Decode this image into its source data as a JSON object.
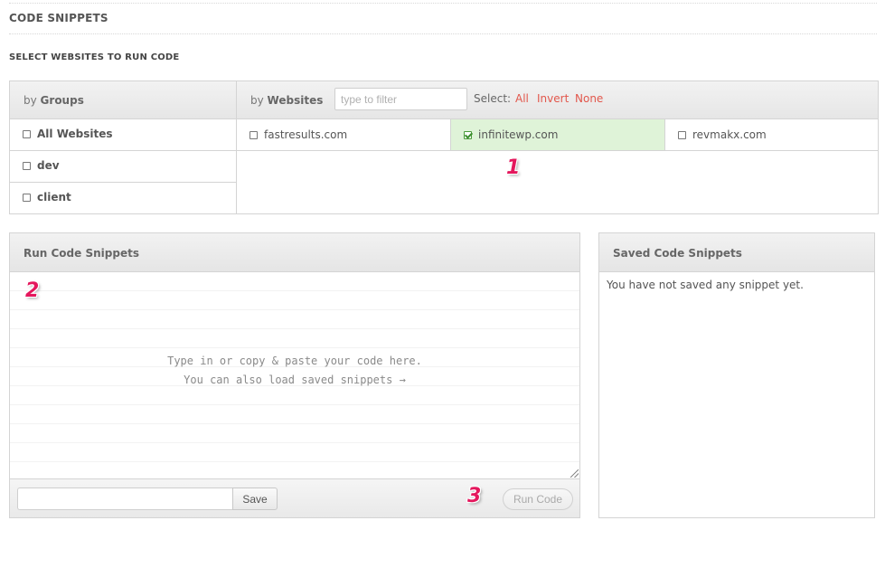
{
  "page": {
    "title": "CODE SNIPPETS",
    "section_title": "SELECT WEBSITES TO RUN CODE"
  },
  "selector": {
    "groups_header_prefix": "by",
    "groups_header": "Groups",
    "websites_header_prefix": "by",
    "websites_header": "Websites",
    "filter_placeholder": "type to filter",
    "select_label": "Select:",
    "select_all": "All",
    "select_invert": "Invert",
    "select_none": "None",
    "groups": [
      {
        "label": "All Websites",
        "checked": false
      },
      {
        "label": "dev",
        "checked": false
      },
      {
        "label": "client",
        "checked": false
      }
    ],
    "websites": [
      {
        "label": "fastresults.com",
        "checked": false
      },
      {
        "label": "infinitewp.com",
        "checked": true
      },
      {
        "label": "revmakx.com",
        "checked": false
      }
    ]
  },
  "run_panel": {
    "title": "Run Code Snippets",
    "placeholder_line1": "Type in or copy & paste your code here.",
    "placeholder_line2": "You can also load saved snippets →",
    "snippet_name_value": "",
    "save_label": "Save",
    "run_label": "Run Code"
  },
  "saved_panel": {
    "title": "Saved Code Snippets",
    "empty_text": "You have not saved any snippet yet."
  },
  "markers": {
    "one": "1",
    "two": "2",
    "three": "3"
  },
  "colors": {
    "link_red": "#e2574c",
    "checked_bg": "#dff3d8",
    "marker_pink": "#e4185d"
  }
}
